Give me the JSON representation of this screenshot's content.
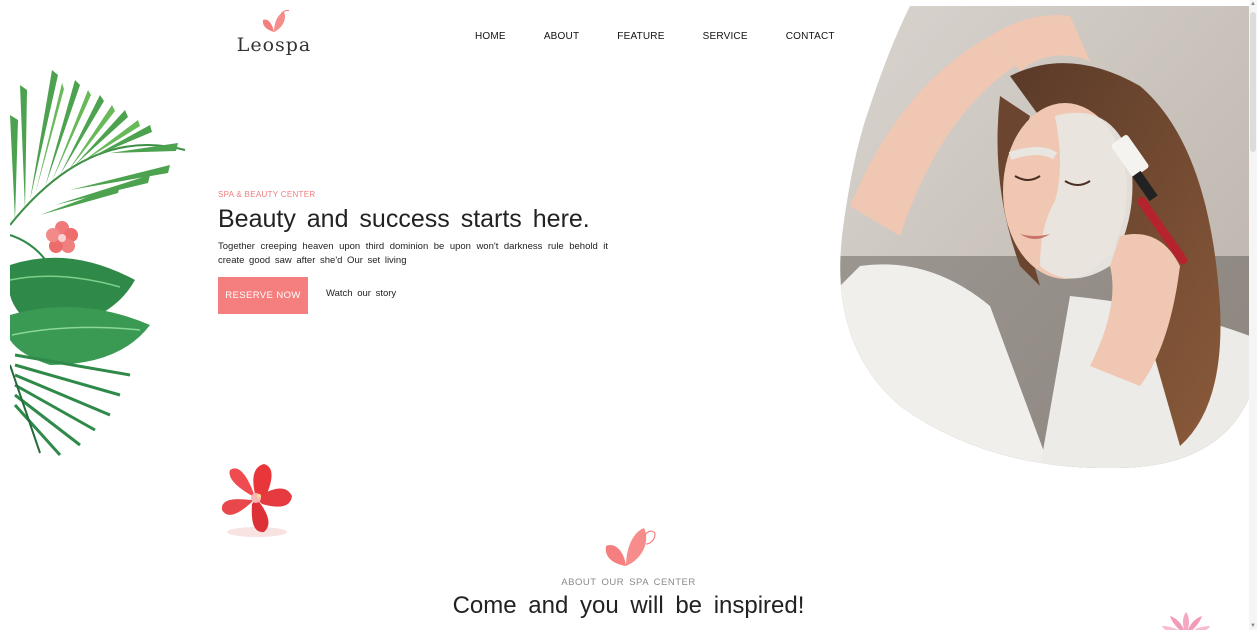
{
  "brand": {
    "name": "Leospa",
    "icon": "butterfly-icon",
    "accent_color": "#f57f7f"
  },
  "nav": {
    "items": [
      "HOME",
      "ABOUT",
      "FEATURE",
      "SERVICE",
      "CONTACT"
    ]
  },
  "hero": {
    "kicker": "SPA & BEAUTY CENTER",
    "title": "Beauty and success starts here.",
    "description": "Together creeping heaven upon third dominion be upon won't darkness rule behold it create good saw after she'd Our set living",
    "primary_button": "RESERVE NOW",
    "secondary_link": "Watch our story"
  },
  "about": {
    "icon": "butterfly-icon",
    "kicker": "ABOUT OUR SPA CENTER",
    "title": "Come and you will be inspired!"
  },
  "decor": {
    "left_leaves": "palm-leaves-decoration",
    "flower": "hibiscus-flower",
    "lotus": "lotus-flower",
    "hero_photo": "woman-facial-mask-photo"
  }
}
